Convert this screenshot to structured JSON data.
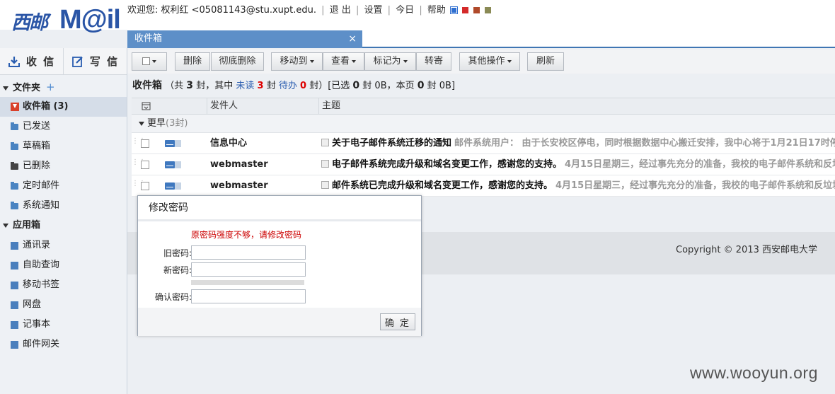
{
  "header": {
    "logo_cn": "西邮",
    "logo_en": "M@il",
    "welcome": "欢迎您: 权利红 <05081143@stu.xupt.edu.",
    "links": [
      "退 出",
      "设置",
      "今日",
      "帮助"
    ],
    "skin_colors": [
      "#2f6fd0",
      "#d42a2a",
      "#b04a2a",
      "#8a8a55"
    ]
  },
  "tabs": [
    {
      "label": "收件箱",
      "close": "×"
    }
  ],
  "sidebar": {
    "receive_label": "收 信",
    "compose_label": "写 信",
    "folders_title": "文件夹",
    "folders_add": "+",
    "folders": [
      {
        "label": "收件箱 (3)"
      },
      {
        "label": "已发送"
      },
      {
        "label": "草稿箱"
      },
      {
        "label": "已删除"
      },
      {
        "label": "定时邮件"
      },
      {
        "label": "系统通知"
      }
    ],
    "apps_title": "应用箱",
    "apps": [
      {
        "label": "通讯录"
      },
      {
        "label": "自助查询"
      },
      {
        "label": "移动书签"
      },
      {
        "label": "网盘"
      },
      {
        "label": "记事本"
      },
      {
        "label": "邮件网关"
      }
    ]
  },
  "toolbar": {
    "delete": "删除",
    "perm_delete": "彻底删除",
    "move_to": "移动到",
    "view": "查看",
    "mark_as": "标记为",
    "forward": "转寄",
    "other_ops": "其他操作",
    "refresh": "刷新"
  },
  "info": {
    "folder": "收件箱",
    "p1": "（共",
    "total": "3",
    "p2": "封，其中",
    "unread_label": "未读",
    "unread": "3",
    "p3": "封",
    "pending_label": "待办",
    "pending": "0",
    "p4": "封）[已选",
    "selected": "0",
    "p5": "封 0B，本页",
    "page_count": "0",
    "p6": "封 0B]"
  },
  "grid": {
    "col_from": "发件人",
    "col_subject": "主题",
    "group_label": "更早",
    "group_count": "(3封)",
    "rows": [
      {
        "from": "信息中心",
        "subject": "关于电子邮件系统迁移的通知",
        "preview": "邮件系统用户： 由于长安校区停电，同时根据数据中心搬迁安排，我中心将于1月21日17时停"
      },
      {
        "from": "webmaster",
        "subject": "电子邮件系统完成升级和域名变更工作，感谢您的支持。",
        "preview": "4月15日星期三，经过事先充分的准备，我校的电子邮件系统和反垃圾"
      },
      {
        "from": "webmaster",
        "subject": "邮件系统已完成升级和域名变更工作，感谢您的支持。",
        "preview": "4月15日星期三，经过事先充分的准备，我校的电子邮件系统和反垃圾"
      }
    ]
  },
  "footer": {
    "copyright": "Copyright © 2013 西安邮电大学"
  },
  "watermark": "www.wooyun.org",
  "modal": {
    "title": "修改密码",
    "warning": "原密码强度不够，请修改密码",
    "old_label": "旧密码:",
    "new_label": "新密码:",
    "confirm_label": "确认密码:",
    "ok": "确 定"
  }
}
